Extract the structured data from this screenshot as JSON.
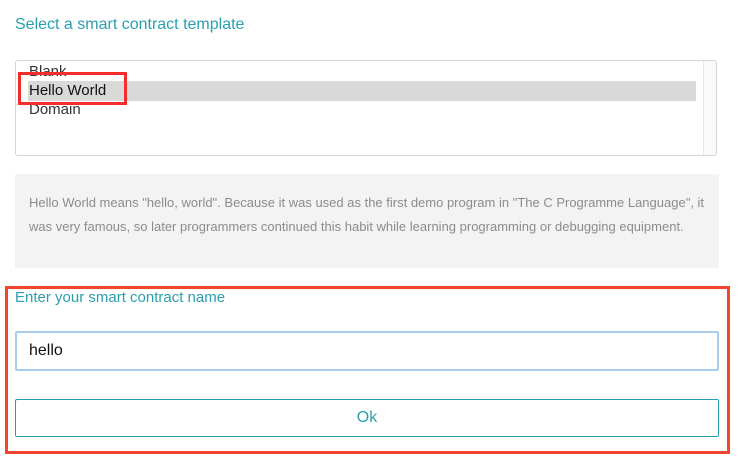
{
  "template_section": {
    "title": "Select a smart contract template",
    "options": [
      {
        "label": "Blank",
        "selected": false
      },
      {
        "label": "Hello World",
        "selected": true
      },
      {
        "label": "Domain",
        "selected": false
      }
    ],
    "description": "Hello World means \"hello, world\". Because it was used as the first demo program in \"The C Programme Language\", it was very famous, so later programmers continued this habit while learning programming or debugging equipment."
  },
  "name_section": {
    "label": "Enter your smart contract name",
    "value": "hello",
    "ok_label": "Ok"
  },
  "colors": {
    "accent": "#2a9fb0",
    "annotation_red": "#f42d2d",
    "selected_bg": "#d9d9d9"
  }
}
